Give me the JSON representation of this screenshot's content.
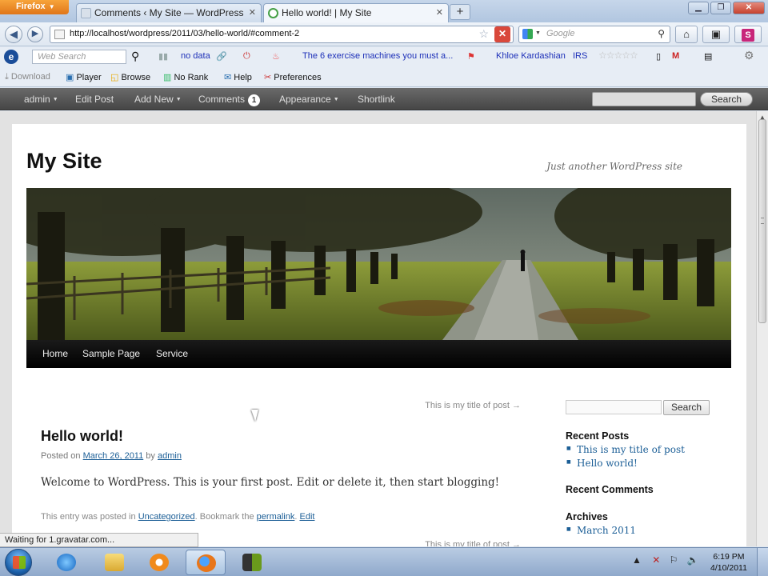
{
  "browser": {
    "app_button": "Firefox",
    "tabs": [
      {
        "label": "Comments ‹ My Site — WordPress"
      },
      {
        "label": "Hello world! | My Site"
      }
    ],
    "url": "http://localhost/wordpress/2011/03/hello-world/#comment-2",
    "search_placeholder": "Google"
  },
  "toolbar1": {
    "web_search_placeholder": "Web Search",
    "no_data": "no data",
    "news_link": "The 6 exercise machines you must a...",
    "celebrity": "Khloe Kardashian",
    "irs": "IRS"
  },
  "toolbar2": {
    "download": "Download",
    "player": "Player",
    "browse": "Browse",
    "no_rank": "No Rank",
    "help": "Help",
    "preferences": "Preferences"
  },
  "adminbar": {
    "user": "admin",
    "edit_post": "Edit Post",
    "add_new": "Add New",
    "comments": "Comments",
    "comments_count": "1",
    "appearance": "Appearance",
    "shortlink": "Shortlink",
    "search_button": "Search"
  },
  "site": {
    "title": "My Site",
    "description": "Just another WordPress site",
    "menu": [
      "Home",
      "Sample Page",
      "Service"
    ]
  },
  "post": {
    "next_link": "This is my title of post →",
    "title": "Hello world!",
    "posted_on": "Posted on",
    "date": "March 26, 2011",
    "by": "by",
    "author": "admin",
    "content": "Welcome to WordPress. This is your first post. Edit or delete it, then start blogging!",
    "foot_prefix": "This entry was posted in",
    "category": "Uncategorized",
    "foot_mid": ". Bookmark the",
    "permalink": "permalink",
    "foot_dot": ".",
    "edit": "Edit"
  },
  "sidebar": {
    "search_button": "Search",
    "recent_posts_title": "Recent Posts",
    "recent_posts": [
      "This is my title of post",
      "Hello world!"
    ],
    "recent_comments_title": "Recent Comments",
    "archives_title": "Archives",
    "archives": [
      "March 2011"
    ]
  },
  "status_text": "Waiting for 1.gravatar.com...",
  "clock": {
    "time": "6:19 PM",
    "date": "4/10/2011"
  },
  "colors": {
    "link": "#1b5e96",
    "adminbar": "#464646",
    "firefox": "#e0761a"
  }
}
